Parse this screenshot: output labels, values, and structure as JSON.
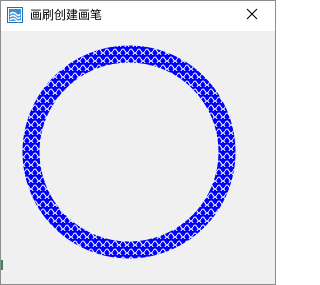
{
  "window": {
    "title": "画刷创建画笔",
    "icon": "app-brush-icon",
    "close_icon": "close-icon"
  },
  "canvas": {
    "ring_color": "#0000ff",
    "pattern_color": "#ffffff",
    "background": "#f0f0f0"
  }
}
